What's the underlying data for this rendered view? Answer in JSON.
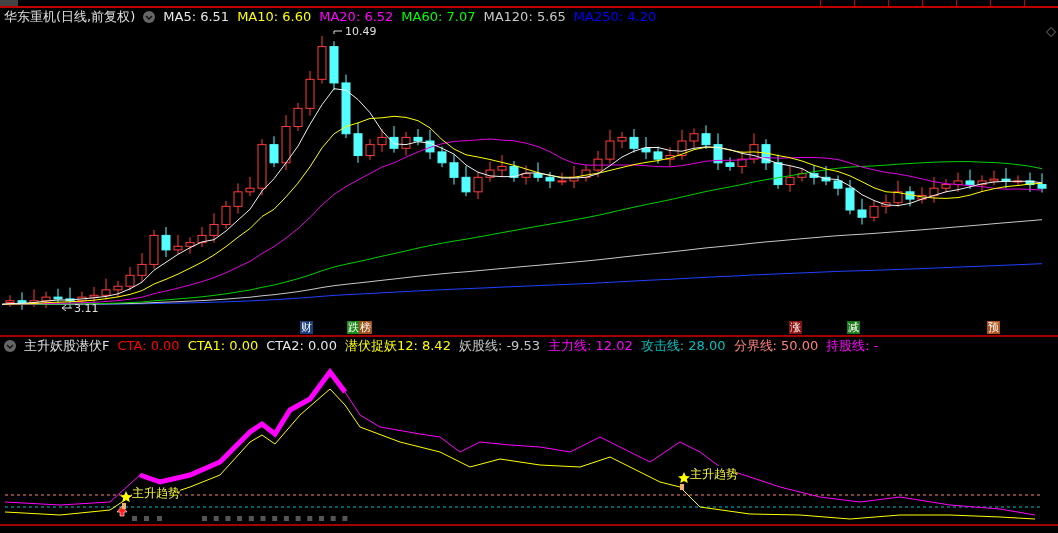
{
  "main_panel": {
    "title": "华东重机(日线,前复权)",
    "ma_legend": [
      {
        "text": "MA5: 6.51",
        "color": "#e8e8e8"
      },
      {
        "text": "MA10: 6.60",
        "color": "#ffff00"
      },
      {
        "text": "MA20: 6.52",
        "color": "#ff00ff"
      },
      {
        "text": "MA60: 7.07",
        "color": "#00ff00"
      },
      {
        "text": "MA120: 5.65",
        "color": "#c8c8c8"
      },
      {
        "text": "MA250: 4.20",
        "color": "#0000ff"
      }
    ],
    "price_labels": [
      "10.49",
      "3.11"
    ],
    "event_markers": [
      {
        "text": "财",
        "color": "#1c3f7a"
      },
      {
        "text": "跌",
        "color": "#1a8a1a"
      },
      {
        "text": "榜",
        "color": "#a0501a"
      },
      {
        "text": "涨",
        "color": "#8a1010"
      },
      {
        "text": "减",
        "color": "#1a7a1a"
      },
      {
        "text": "预",
        "color": "#b0501a"
      }
    ]
  },
  "indicator_panel": {
    "title": "主升妖股潜伏F",
    "legend": [
      {
        "text": "CTA: 0.00",
        "color": "#ff0000"
      },
      {
        "text": "CTA1: 0.00",
        "color": "#ffff00"
      },
      {
        "text": "CTA2: 0.00",
        "color": "#e8e8e8"
      },
      {
        "text": "潜伏捉妖12: 8.42",
        "color": "#ffff00"
      },
      {
        "text": "妖股线: -9.53",
        "color": "#c8c8c8"
      },
      {
        "text": "主力线: 12.02",
        "color": "#ff00ff"
      },
      {
        "text": "攻击线: 28.00",
        "color": "#00c0c0"
      },
      {
        "text": "分界线: 50.00",
        "color": "#ff8080"
      },
      {
        "text": "持股线: -",
        "color": "#ff00ff"
      }
    ],
    "signals": [
      "主升趋势",
      "主升趋势"
    ]
  }
}
